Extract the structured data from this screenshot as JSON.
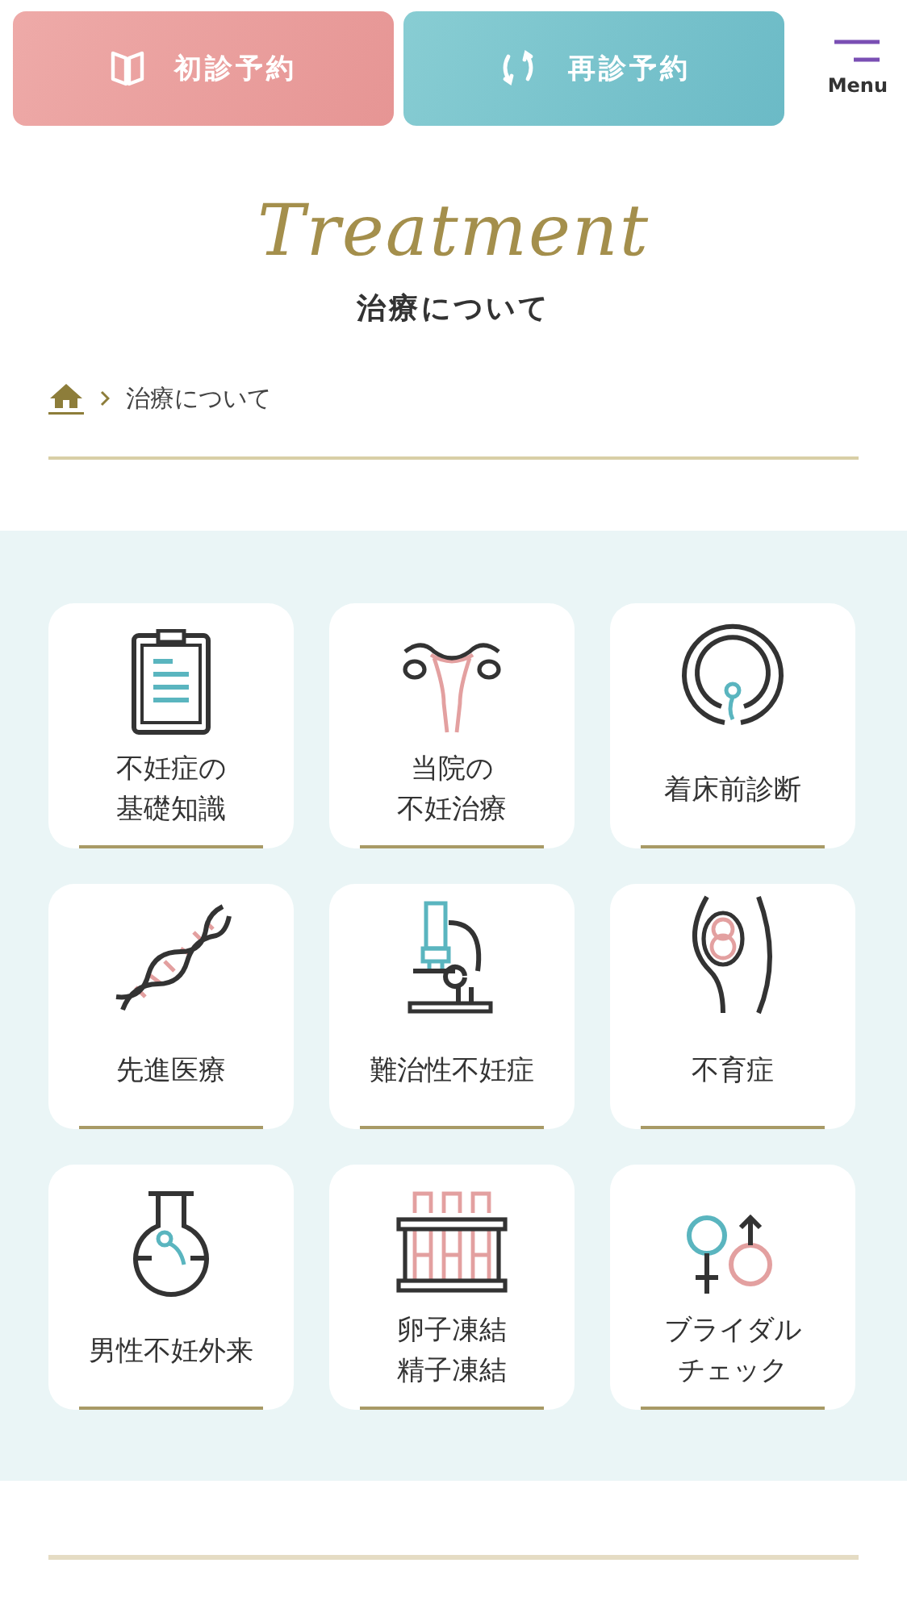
{
  "header": {
    "buttons": [
      {
        "kind": "first",
        "label": "初診予約"
      },
      {
        "kind": "return",
        "label": "再診予約"
      }
    ],
    "menu_label": "Menu"
  },
  "page_title": {
    "script": "Treatment",
    "heading": "治療について"
  },
  "breadcrumb": {
    "current": "治療について"
  },
  "cards": [
    {
      "kind": "clipboard",
      "lines": [
        "不妊症の",
        "基礎知識"
      ]
    },
    {
      "kind": "uterus",
      "lines": [
        "当院の",
        "不妊治療"
      ]
    },
    {
      "kind": "ring",
      "lines": [
        "着床前診断"
      ]
    },
    {
      "kind": "dna",
      "lines": [
        "先進医療"
      ]
    },
    {
      "kind": "microscope",
      "lines": [
        "難治性不妊症"
      ]
    },
    {
      "kind": "womb",
      "lines": [
        "不育症"
      ]
    },
    {
      "kind": "flask",
      "lines": [
        "男性不妊外来"
      ]
    },
    {
      "kind": "tubes",
      "lines": [
        "卵子凍結",
        "精子凍結"
      ]
    },
    {
      "kind": "gender",
      "lines": [
        "ブライダル",
        "チェック"
      ]
    }
  ]
}
